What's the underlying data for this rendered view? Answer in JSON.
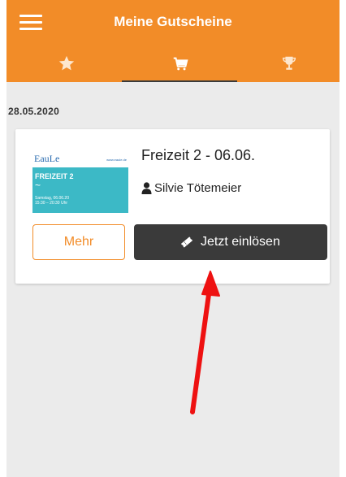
{
  "header": {
    "title": "Meine Gutscheine",
    "menu_icon": "hamburger-menu-icon"
  },
  "tabs": [
    {
      "icon": "star-icon",
      "active": false
    },
    {
      "icon": "cart-icon",
      "active": true
    },
    {
      "icon": "trophy-icon",
      "active": false
    }
  ],
  "voucher_group": {
    "date": "28.05.2020",
    "voucher": {
      "title": "Freizeit 2 - 06.06.",
      "owner_icon": "person-icon",
      "owner": "Silvie Tötemeier",
      "thumbnail": {
        "logo": "EauLe",
        "url": "www.eaule.de",
        "event": "FREIZEIT 2",
        "wave": "~",
        "date_line": "Samstag, 06.06.20",
        "time_line": "15:30 – 20:30 Uhr"
      },
      "more_label": "Mehr",
      "redeem_label": "Jetzt einlösen",
      "redeem_icon": "ticket-icon"
    }
  },
  "colors": {
    "brand_orange": "#f28c28",
    "dark_button": "#3a3a3a",
    "background": "#ebebeb",
    "annotation_arrow": "#ee1111"
  }
}
